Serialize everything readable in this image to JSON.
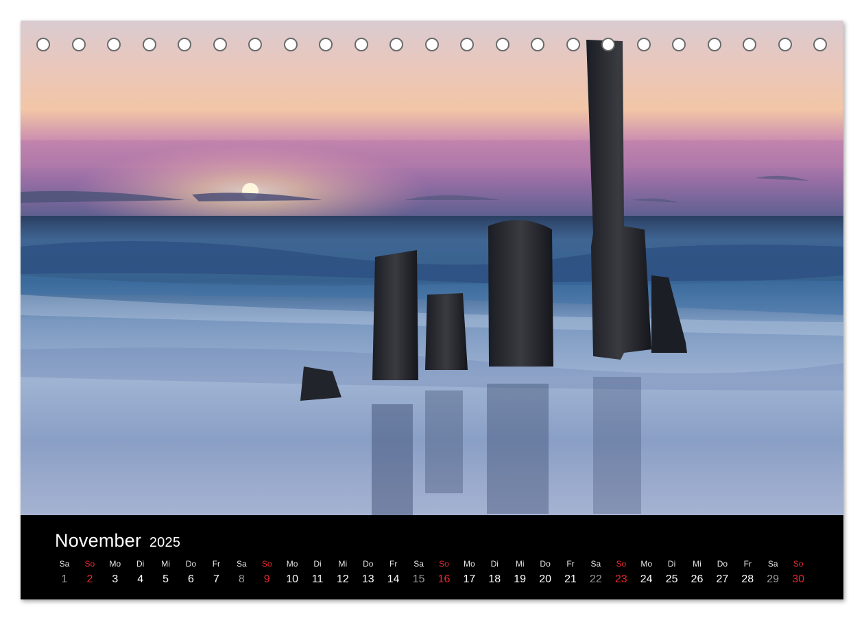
{
  "calendar": {
    "month": "November",
    "year": "2025",
    "days": [
      {
        "wd": "Sa",
        "n": "1",
        "kind": "sat"
      },
      {
        "wd": "So",
        "n": "2",
        "kind": "sun"
      },
      {
        "wd": "Mo",
        "n": "3",
        "kind": ""
      },
      {
        "wd": "Di",
        "n": "4",
        "kind": ""
      },
      {
        "wd": "Mi",
        "n": "5",
        "kind": ""
      },
      {
        "wd": "Do",
        "n": "6",
        "kind": ""
      },
      {
        "wd": "Fr",
        "n": "7",
        "kind": ""
      },
      {
        "wd": "Sa",
        "n": "8",
        "kind": "sat"
      },
      {
        "wd": "So",
        "n": "9",
        "kind": "sun"
      },
      {
        "wd": "Mo",
        "n": "10",
        "kind": ""
      },
      {
        "wd": "Di",
        "n": "11",
        "kind": ""
      },
      {
        "wd": "Mi",
        "n": "12",
        "kind": ""
      },
      {
        "wd": "Do",
        "n": "13",
        "kind": ""
      },
      {
        "wd": "Fr",
        "n": "14",
        "kind": ""
      },
      {
        "wd": "Sa",
        "n": "15",
        "kind": "sat"
      },
      {
        "wd": "So",
        "n": "16",
        "kind": "sun"
      },
      {
        "wd": "Mo",
        "n": "17",
        "kind": ""
      },
      {
        "wd": "Di",
        "n": "18",
        "kind": ""
      },
      {
        "wd": "Mi",
        "n": "19",
        "kind": ""
      },
      {
        "wd": "Do",
        "n": "20",
        "kind": ""
      },
      {
        "wd": "Fr",
        "n": "21",
        "kind": ""
      },
      {
        "wd": "Sa",
        "n": "22",
        "kind": "sat"
      },
      {
        "wd": "So",
        "n": "23",
        "kind": "sun"
      },
      {
        "wd": "Mo",
        "n": "24",
        "kind": ""
      },
      {
        "wd": "Di",
        "n": "25",
        "kind": ""
      },
      {
        "wd": "Mi",
        "n": "26",
        "kind": ""
      },
      {
        "wd": "Do",
        "n": "27",
        "kind": ""
      },
      {
        "wd": "Fr",
        "n": "28",
        "kind": ""
      },
      {
        "wd": "Sa",
        "n": "29",
        "kind": "sat"
      },
      {
        "wd": "So",
        "n": "30",
        "kind": "sun"
      }
    ]
  },
  "binding": {
    "hole_count": 23
  },
  "colors": {
    "sunday": "#e8282f",
    "saturday_number": "#9a9a9a",
    "footer_bg": "#000000"
  }
}
